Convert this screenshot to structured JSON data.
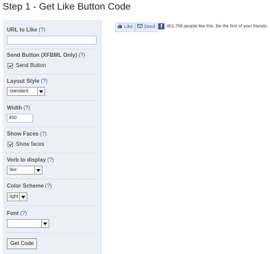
{
  "page": {
    "title": "Step 1 - Get Like Button Code"
  },
  "help_text": "(?)",
  "form": {
    "url": {
      "label": "URL to Like",
      "value": ""
    },
    "send_button": {
      "label": "Send Button (XFBML Only)",
      "checkbox_label": "Send Button",
      "checked": true
    },
    "layout_style": {
      "label": "Layout Style",
      "value": "standard"
    },
    "width": {
      "label": "Width",
      "value": "450"
    },
    "show_faces": {
      "label": "Show Faces",
      "checkbox_label": "Show faces",
      "checked": true
    },
    "verb": {
      "label": "Verb to display",
      "value": "like"
    },
    "color_scheme": {
      "label": "Color Scheme",
      "value": "light"
    },
    "font": {
      "label": "Font",
      "value": ""
    },
    "submit_label": "Get Code"
  },
  "preview": {
    "like_label": "Like",
    "send_label": "Send",
    "logo": "f",
    "social_text": "401,759 people like this. Be the first of your friends.",
    "icons": [
      "thumbs-up-icon",
      "send-envelope-icon",
      "facebook-logo-icon"
    ],
    "colors": {
      "link": "#3b5998",
      "panel": "#eceff5"
    }
  }
}
